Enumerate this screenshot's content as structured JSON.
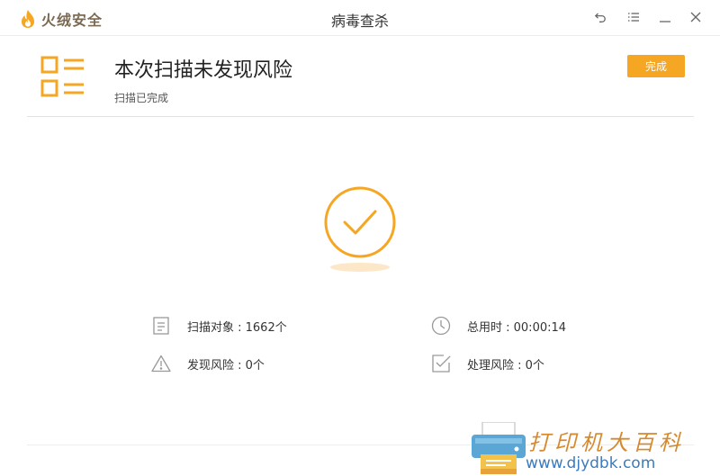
{
  "titlebar": {
    "brand_name": "火绒安全",
    "window_title": "病毒查杀",
    "buttons": {
      "back_icon": "back-arrow-icon",
      "menu_icon": "menu-icon",
      "minimize_icon": "minimize-icon",
      "close_icon": "close-icon"
    }
  },
  "header": {
    "title": "本次扫描未发现风险",
    "subtitle": "扫描已完成",
    "done_label": "完成"
  },
  "status": {
    "icon": "check-circle-icon"
  },
  "stats": {
    "scanned": "扫描对象 : 1662个",
    "duration": "总用时 : 00:00:14",
    "found": "发现风险 : 0个",
    "handled": "处理风险 : 0个"
  },
  "watermark": {
    "text": "打印机大百科",
    "url": "www.djydbk.com"
  },
  "colors": {
    "accent": "#f5a623",
    "brand_text": "#7a6a53"
  }
}
